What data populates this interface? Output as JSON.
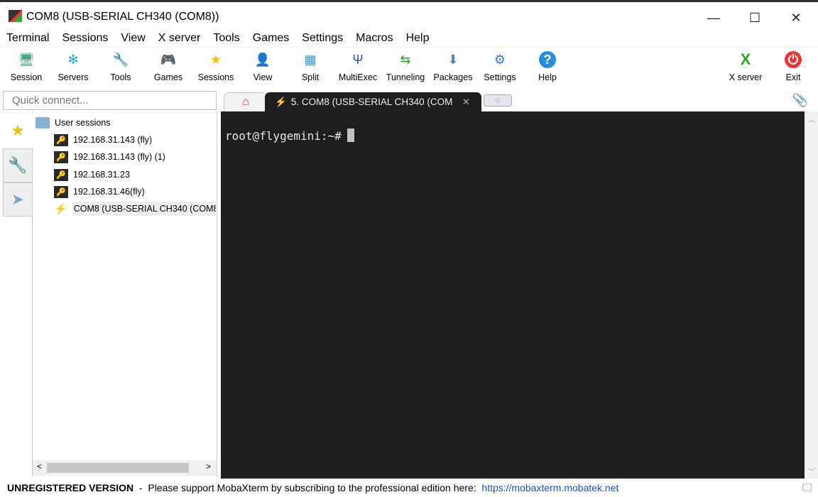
{
  "window": {
    "title": "COM8  (USB-SERIAL CH340 (COM8))",
    "minimize": "—",
    "maximize": "☐",
    "close": "✕"
  },
  "menu": [
    "Terminal",
    "Sessions",
    "View",
    "X server",
    "Tools",
    "Games",
    "Settings",
    "Macros",
    "Help"
  ],
  "toolbar": [
    {
      "label": "Session",
      "icon": "session-icon",
      "glyph": "🖥",
      "color": "#4a8"
    },
    {
      "label": "Servers",
      "icon": "servers-icon",
      "glyph": "✻",
      "color": "#3ab"
    },
    {
      "label": "Tools",
      "icon": "tools-icon",
      "glyph": "🔧",
      "color": "#e54"
    },
    {
      "label": "Games",
      "icon": "games-icon",
      "glyph": "🎮",
      "color": "#888"
    },
    {
      "label": "Sessions",
      "icon": "star-icon",
      "glyph": "★",
      "color": "#f0c000"
    },
    {
      "label": "View",
      "icon": "view-icon",
      "glyph": "👤",
      "color": "#4a8"
    },
    {
      "label": "Split",
      "icon": "split-icon",
      "glyph": "▦",
      "color": "#39c"
    },
    {
      "label": "MultiExec",
      "icon": "multiexec-icon",
      "glyph": "Ψ",
      "color": "#35b"
    },
    {
      "label": "Tunneling",
      "icon": "tunneling-icon",
      "glyph": "⇆",
      "color": "#393"
    },
    {
      "label": "Packages",
      "icon": "packages-icon",
      "glyph": "⬇",
      "color": "#58a"
    },
    {
      "label": "Settings",
      "icon": "settings-icon",
      "glyph": "⚙",
      "color": "#37c"
    },
    {
      "label": "Help",
      "icon": "help-icon",
      "glyph": "?",
      "color": "#fff"
    }
  ],
  "toolbar_right": [
    {
      "label": "X server",
      "icon": "x-server-icon",
      "glyph": "X"
    },
    {
      "label": "Exit",
      "icon": "power-icon",
      "glyph": "⏻"
    }
  ],
  "quick_connect": {
    "placeholder": "Quick connect..."
  },
  "tabs": {
    "home_icon": "⌂",
    "active": "5. COM8  (USB-SERIAL CH340 (COM",
    "close": "✕",
    "new": "◇",
    "attach_icon": "📎"
  },
  "sessions": {
    "folder": "User sessions",
    "items": [
      "192.168.31.143 (fly)",
      "192.168.31.143 (fly) (1)",
      "192.168.31.23",
      "192.168.31.46(fly)",
      "COM8  (USB-SERIAL CH340 (COM8"
    ]
  },
  "terminal": {
    "prompt": "root@flygemini:~#"
  },
  "status": {
    "unregistered": "UNREGISTERED VERSION",
    "message": "  -  Please support MobaXterm by subscribing to the professional edition here:  ",
    "link": "https://mobaxterm.mobatek.net"
  }
}
